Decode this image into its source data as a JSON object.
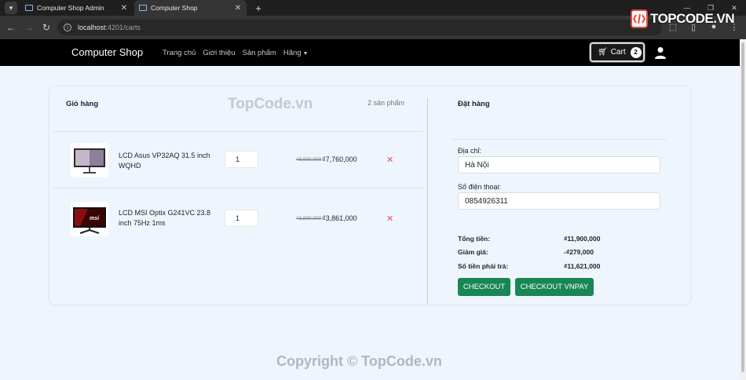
{
  "browser": {
    "tabs": [
      {
        "title": "Computer Shop Admin",
        "active": false
      },
      {
        "title": "Computer Shop",
        "active": true
      }
    ],
    "url_host": "localhost",
    "url_path": ":4201/carts"
  },
  "watermark": {
    "logo": "TOPCODE.VN",
    "center": "TopCode.vn",
    "footer": "Copyright © TopCode.vn"
  },
  "navbar": {
    "brand": "Computer Shop",
    "links": [
      "Trang chủ",
      "Giới thiệu",
      "Sản phẩm",
      "Hãng"
    ],
    "cart_label": "Cart",
    "cart_count": "2"
  },
  "cart": {
    "title": "Giỏ hàng",
    "item_count": "2 sản phẩm",
    "items": [
      {
        "name": "LCD Asus VP32AQ 31.5 inch WQHD",
        "quantity": "1",
        "old_price": "₫8,000,000",
        "price": "₫7,760,000",
        "remove": "✕"
      },
      {
        "name": "LCD MSI Optix G241VC 23.8 inch 75Hz 1ms",
        "quantity": "1",
        "old_price": "₫3,900,000",
        "price": "₫3,861,000",
        "remove": "✕"
      }
    ]
  },
  "order": {
    "title": "Đặt hàng",
    "address_label": "Địa chỉ:",
    "address_value": "Hà Nội",
    "phone_label": "Số điện thoại:",
    "phone_value": "0854926311",
    "total_label": "Tổng tiền:",
    "total_value": "₫11,900,000",
    "discount_label": "Giảm giá:",
    "discount_value": "-₫279,000",
    "pay_label": "Số tiền phải trả:",
    "pay_value": "₫11,621,000",
    "checkout_button": "CHECKOUT",
    "vnpay_button": "CHECKOUT VNPAY"
  },
  "colors": {
    "navbar": "#000000",
    "accent_green": "#198754",
    "remove_red": "#e05050",
    "page_bg": "#eef5fd"
  }
}
